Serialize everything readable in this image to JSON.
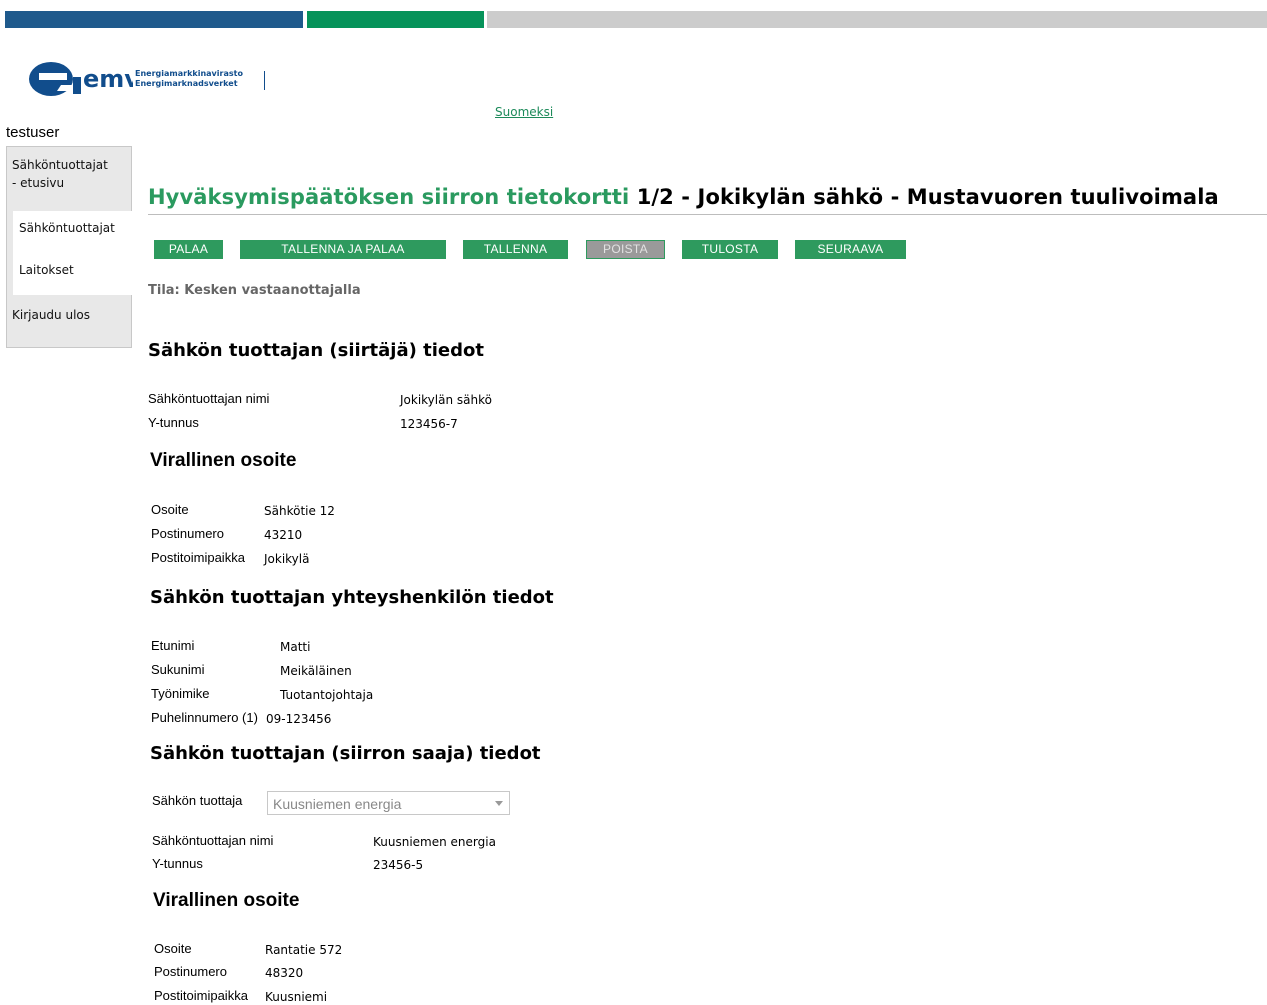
{
  "header": {
    "logo_text": "emv",
    "org_name_fi": "Energiamarkkinavirasto",
    "org_name_sv": "Energimarknadsverket",
    "language_link": "Suomeksi",
    "colors": {
      "blue": "#1f5a8c",
      "green": "#06935a",
      "gray": "#cccccc"
    }
  },
  "user": {
    "name": "testuser"
  },
  "sidebar": {
    "items": [
      {
        "label_line1": "Sähköntuottajat",
        "label_line2": "- etusivu"
      },
      {
        "label": "Sähköntuottajat"
      },
      {
        "label": "Laitokset"
      },
      {
        "label": "Kirjaudu ulos"
      }
    ]
  },
  "page": {
    "title_green": "Hyväksymispäätöksen siirron tietokortti",
    "title_black": "1/2 - Jokikylän sähkö - Mustavuoren tuulivoimala",
    "status": "Tila: Kesken vastaanottajalla"
  },
  "toolbar": {
    "back": "PALAA",
    "save_and_back": "TALLENNA JA PALAA",
    "save": "TALLENNA",
    "delete": "POISTA",
    "print": "TULOSTA",
    "next": "SEURAAVA"
  },
  "transferrer": {
    "heading": "Sähkön tuottajan (siirtäjä) tiedot",
    "name_label": "Sähköntuottajan nimi",
    "name_value": "Jokikylän sähkö",
    "id_label": "Y-tunnus",
    "id_value": "123456-7"
  },
  "transferrer_address": {
    "heading": "Virallinen osoite",
    "street_label": "Osoite",
    "street_value": "Sähkötie 12",
    "postcode_label": "Postinumero",
    "postcode_value": "43210",
    "city_label": "Postitoimipaikka",
    "city_value": "Jokikylä"
  },
  "contact": {
    "heading": "Sähkön tuottajan yhteyshenkilön tiedot",
    "first_name_label": "Etunimi",
    "first_name_value": "Matti",
    "last_name_label": "Sukunimi",
    "last_name_value": "Meikäläinen",
    "title_label": "Työnimike",
    "title_value": "Tuotantojohtaja",
    "phone_label": "Puhelinnumero (1)",
    "phone_value": "09-123456"
  },
  "receiver": {
    "heading": "Sähkön tuottajan (siirron saaja) tiedot",
    "select_label": "Sähkön tuottaja",
    "select_value": "Kuusniemen energia",
    "name_label": "Sähköntuottajan nimi",
    "name_value": "Kuusniemen energia",
    "id_label": "Y-tunnus",
    "id_value": "23456-5"
  },
  "receiver_address": {
    "heading": "Virallinen osoite",
    "street_label": "Osoite",
    "street_value": "Rantatie 572",
    "postcode_label": "Postinumero",
    "postcode_value": "48320",
    "city_label": "Postitoimipaikka",
    "city_value": "Kuusniemi"
  }
}
